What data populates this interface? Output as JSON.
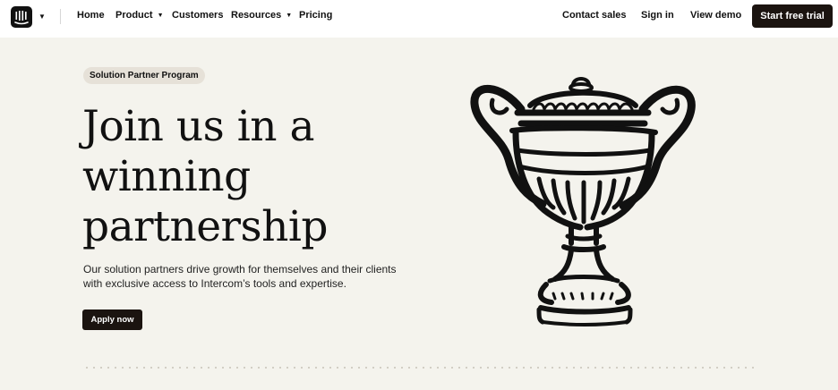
{
  "nav": {
    "logo": "intercom-logo-icon",
    "links": {
      "home": "Home",
      "product": "Product",
      "customers": "Customers",
      "resources": "Resources",
      "pricing": "Pricing",
      "contact_sales": "Contact sales",
      "sign_in": "Sign in",
      "view_demo": "View demo"
    },
    "cta": "Start free trial"
  },
  "hero": {
    "badge": "Solution Partner Program",
    "headline_lines": [
      "Join us in a",
      "winning",
      "partnership"
    ],
    "subtext_lines": [
      "Our solution partners drive growth for themselves and their clients",
      "with exclusive access to Intercom’s tools and expertise."
    ],
    "apply_button": "Apply now",
    "illustration": "trophy-icon"
  },
  "colors": {
    "page_bg": "#f4f3ed",
    "nav_bg": "#ffffff",
    "button_dark": "#1b1410",
    "badge_bg": "#e6e1d8"
  }
}
